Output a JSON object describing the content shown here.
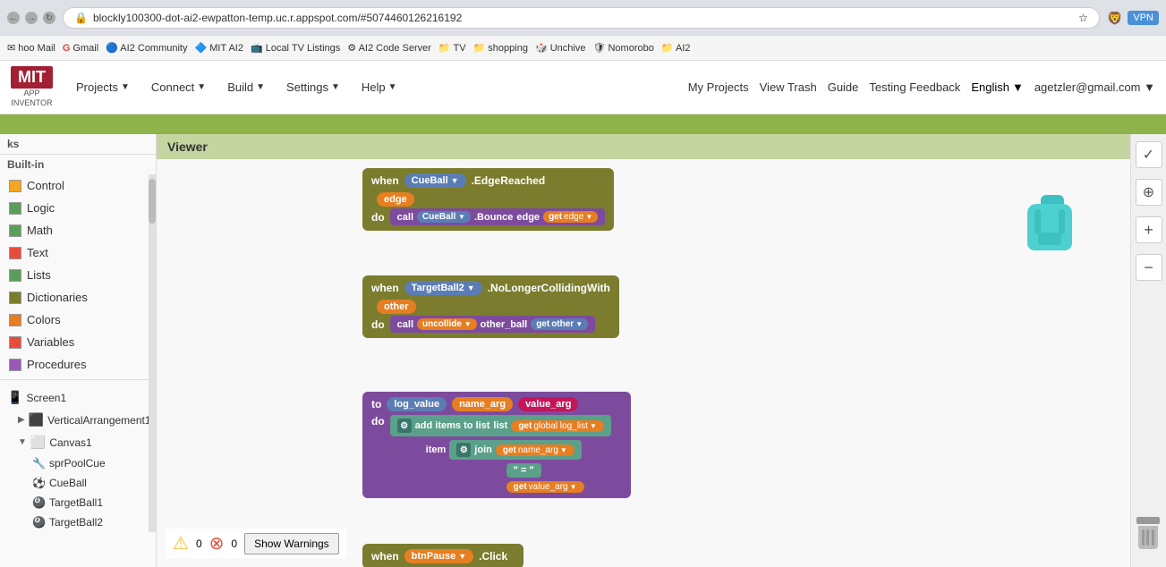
{
  "browser": {
    "back_btn": "←",
    "forward_btn": "→",
    "refresh_btn": "↻",
    "url": "blockly100300-dot-ai2-ewpatton-temp.uc.r.appspot.com/#5074460126216192",
    "shield_icon": "🛡",
    "vpn_label": "VPN"
  },
  "bookmarks": [
    {
      "label": "hoo Mail",
      "icon": "✉"
    },
    {
      "label": "Gmail",
      "icon": "M"
    },
    {
      "label": "AI2 Community",
      "icon": "🔵"
    },
    {
      "label": "MIT AI2",
      "icon": "🔷"
    },
    {
      "label": "Local TV Listings",
      "icon": "📺"
    },
    {
      "label": "AI2 Code Server",
      "icon": "⚙"
    },
    {
      "label": "TV",
      "icon": "📁"
    },
    {
      "label": "shopping",
      "icon": "📁"
    },
    {
      "label": "Unchive",
      "icon": "🎲"
    },
    {
      "label": "Nomorobo",
      "icon": "🛡"
    },
    {
      "label": "AI2",
      "icon": "📁"
    }
  ],
  "app": {
    "logo_text": "MIT",
    "logo_sub": "APP\nINVENTOR",
    "nav": [
      "Projects",
      "Connect",
      "Build",
      "Settings",
      "Help"
    ],
    "header_links": [
      "My Projects",
      "View Trash",
      "Guide",
      "Testing Feedback"
    ],
    "lang": "English",
    "user": "agetzler@gmail.com"
  },
  "left_panel": {
    "header": "ks",
    "builtin_label": "Built-in",
    "items": [
      {
        "label": "Control",
        "color": "#f5a623"
      },
      {
        "label": "Logic",
        "color": "#5b9e5b"
      },
      {
        "label": "Math",
        "color": "#5b9e5b"
      },
      {
        "label": "Text",
        "color": "#e74c3c"
      },
      {
        "label": "Lists",
        "color": "#5b9e5b"
      },
      {
        "label": "Dictionaries",
        "color": "#7b7c2e"
      },
      {
        "label": "Colors",
        "color": "#e67e22"
      },
      {
        "label": "Variables",
        "color": "#e74c3c"
      },
      {
        "label": "Procedures",
        "color": "#9b59b6"
      }
    ],
    "tree": [
      {
        "label": "Screen1",
        "type": "screen",
        "expanded": false
      },
      {
        "label": "VerticalArrangement1",
        "type": "layout",
        "expanded": false,
        "indent": 1
      },
      {
        "label": "Canvas1",
        "type": "canvas",
        "expanded": true,
        "indent": 1
      },
      {
        "label": "sprPoolCue",
        "type": "sprite",
        "indent": 2
      },
      {
        "label": "CueBall",
        "type": "ball",
        "indent": 2
      },
      {
        "label": "TargetBall1",
        "type": "ball",
        "indent": 2
      },
      {
        "label": "TargetBall2",
        "type": "ball",
        "indent": 2
      }
    ]
  },
  "viewer": {
    "title": "Viewer",
    "blocks": {
      "when1": {
        "component": "CueBall",
        "event": "EdgeReached",
        "param": "edge",
        "call_component": "CueBall",
        "call_method": "Bounce",
        "call_param1": "edge",
        "get_label": "get",
        "get_value": "edge"
      },
      "when2": {
        "component": "TargetBall2",
        "event": "NoLongerCollidingWith",
        "param": "other",
        "call_method": "uncollide",
        "call_param1": "other_ball",
        "get_label": "get",
        "get_value": "other"
      },
      "proc1": {
        "label": "to",
        "name": "log_value",
        "param1": "name_arg",
        "param2": "value_arg",
        "do_label": "do",
        "add_items": "add items to list",
        "list_label": "list",
        "get_global_label": "get",
        "get_global_value": "global log_list",
        "item_label": "item",
        "join_label": "join",
        "get_name": "get",
        "get_name_val": "name_arg",
        "equals_str": "\" = \"",
        "get_val": "get",
        "get_val_val": "value_arg"
      },
      "when3": {
        "component": "btnPause",
        "event": "Click"
      }
    }
  },
  "bottom_toolbar": {
    "warn_icon1": "⚠",
    "warn_count1": "0",
    "warn_icon2": "⊗",
    "warn_count2": "0",
    "show_warnings_btn": "Show Warnings"
  },
  "right_panel": {
    "icons": [
      "✓",
      "⊕",
      "+",
      "−"
    ]
  }
}
